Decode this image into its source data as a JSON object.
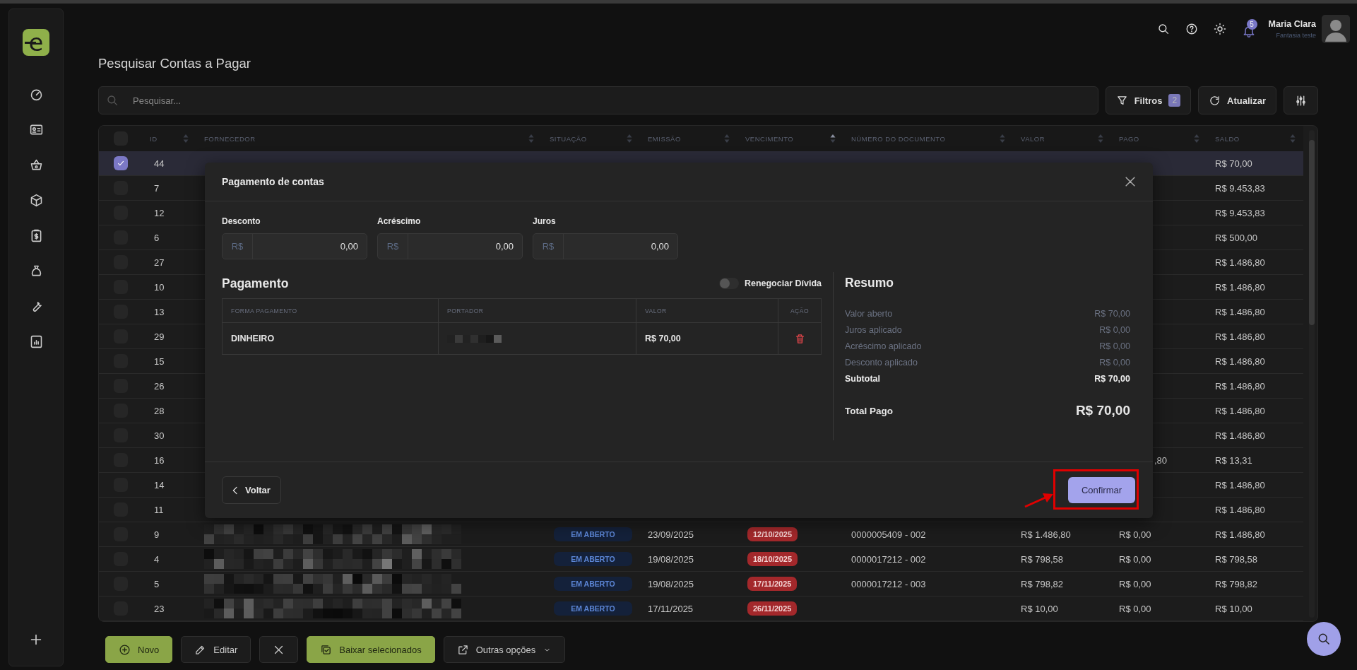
{
  "brand_mark": "e",
  "header": {
    "notifications": "5",
    "user": {
      "name": "Maria Clara",
      "company": "Fantasia teste"
    }
  },
  "title": "Pesquisar Contas a Pagar",
  "search": {
    "placeholder": "Pesquisar..."
  },
  "toolbar": {
    "filters": {
      "label": "Filtros",
      "count": "2"
    },
    "refresh": {
      "label": "Atualizar"
    }
  },
  "table": {
    "header_checkbox": {
      "checked": false
    },
    "columns": [
      {
        "label": "ID",
        "sorted": false
      },
      {
        "label": "FORNECEDOR",
        "sorted": false
      },
      {
        "label": "SITUAÇÃO",
        "sorted": false
      },
      {
        "label": "EMISSÃO",
        "sorted": false
      },
      {
        "label": "VENCIMENTO",
        "sorted": true
      },
      {
        "label": "NÚMERO DO DOCUMENTO",
        "sorted": false
      },
      {
        "label": "VALOR",
        "sorted": false
      },
      {
        "label": "PAGO",
        "sorted": false
      },
      {
        "label": "SALDO",
        "sorted": false
      }
    ],
    "rows": [
      {
        "id": "44",
        "selected": true,
        "saldo": "R$ 70,00"
      },
      {
        "id": "7",
        "selected": false,
        "saldo": "R$ 9.453,83"
      },
      {
        "id": "12",
        "selected": false,
        "saldo": "R$ 9.453,83"
      },
      {
        "id": "6",
        "selected": false,
        "saldo": "R$ 500,00"
      },
      {
        "id": "27",
        "selected": false,
        "saldo": "R$ 1.486,80"
      },
      {
        "id": "10",
        "selected": false,
        "saldo": "R$ 1.486,80"
      },
      {
        "id": "13",
        "selected": false,
        "saldo": "R$ 1.486,80"
      },
      {
        "id": "29",
        "selected": false,
        "saldo": "R$ 1.486,80"
      },
      {
        "id": "15",
        "selected": false,
        "saldo": "R$ 1.486,80"
      },
      {
        "id": "26",
        "selected": false,
        "saldo": "R$ 1.486,80"
      },
      {
        "id": "28",
        "selected": false,
        "saldo": "R$ 1.486,80"
      },
      {
        "id": "30",
        "selected": false,
        "saldo": "R$ 1.486,80"
      },
      {
        "id": "16",
        "selected": false,
        "pago": ",80",
        "saldo": "R$ 13,31"
      },
      {
        "id": "14",
        "selected": false,
        "saldo": "R$ 1.486,80"
      },
      {
        "id": "11",
        "selected": false,
        "saldo": "R$ 1.486,80"
      },
      {
        "id": "9",
        "selected": false,
        "fornecedor_redacted": true,
        "situacao": "EM ABERTO",
        "emissao": "23/09/2025",
        "vencimento": "12/10/2025",
        "numero_documento": "0000005409 - 002",
        "valor": "R$ 1.486,80",
        "pago": "R$ 0,00",
        "saldo": "R$ 1.486,80"
      },
      {
        "id": "4",
        "selected": false,
        "fornecedor_redacted": true,
        "situacao": "EM ABERTO",
        "emissao": "19/08/2025",
        "vencimento": "18/10/2025",
        "numero_documento": "0000017212 - 002",
        "valor": "R$ 798,58",
        "pago": "R$ 0,00",
        "saldo": "R$ 798,58"
      },
      {
        "id": "5",
        "selected": false,
        "fornecedor_redacted": true,
        "situacao": "EM ABERTO",
        "emissao": "19/08/2025",
        "vencimento": "17/11/2025",
        "numero_documento": "0000017212 - 003",
        "valor": "R$ 798,82",
        "pago": "R$ 0,00",
        "saldo": "R$ 798,82"
      },
      {
        "id": "23",
        "selected": false,
        "fornecedor_redacted": true,
        "situacao": "EM ABERTO",
        "emissao": "17/11/2025",
        "vencimento": "26/11/2025",
        "valor": "R$ 10,00",
        "pago": "R$ 0,00",
        "saldo": "R$ 10,00"
      }
    ]
  },
  "modal": {
    "title": "Pagamento de contas",
    "fields": [
      {
        "label": "Desconto",
        "prefix": "R$",
        "value": "0,00"
      },
      {
        "label": "Acréscimo",
        "prefix": "R$",
        "value": "0,00"
      },
      {
        "label": "Juros",
        "prefix": "R$",
        "value": "0,00"
      }
    ],
    "payment": {
      "title": "Pagamento",
      "renegotiate": {
        "label": "Renegociar Dívida",
        "on": false
      },
      "columns": [
        "FORMA PAGAMENTO",
        "PORTADOR",
        "VALOR",
        "AÇÃO"
      ],
      "rows": [
        {
          "forma": "DINHEIRO",
          "portador_redacted": true,
          "valor": "R$ 70,00"
        }
      ]
    },
    "summary": {
      "title": "Resumo",
      "lines": [
        {
          "label": "Valor aberto",
          "value": "R$ 70,00",
          "kind": "detail"
        },
        {
          "label": "Juros aplicado",
          "value": "R$ 0,00",
          "kind": "detail"
        },
        {
          "label": "Acréscimo aplicado",
          "value": "R$ 0,00",
          "kind": "detail"
        },
        {
          "label": "Desconto aplicado",
          "value": "R$ 0,00",
          "kind": "detail"
        },
        {
          "label": "Subtotal",
          "value": "R$ 70,00",
          "kind": "subtotal"
        }
      ],
      "total": {
        "label": "Total Pago",
        "value": "R$ 70,00"
      }
    },
    "back": "Voltar",
    "confirm": "Confirmar",
    "confirm_highlighted": true
  },
  "actions": [
    {
      "kind": "primary",
      "label": "Novo"
    },
    {
      "kind": "default",
      "label": "Editar"
    },
    {
      "kind": "close"
    },
    {
      "kind": "primary",
      "label": "Baixar selecionados"
    },
    {
      "kind": "dropdown",
      "label": "Outras opções"
    }
  ]
}
